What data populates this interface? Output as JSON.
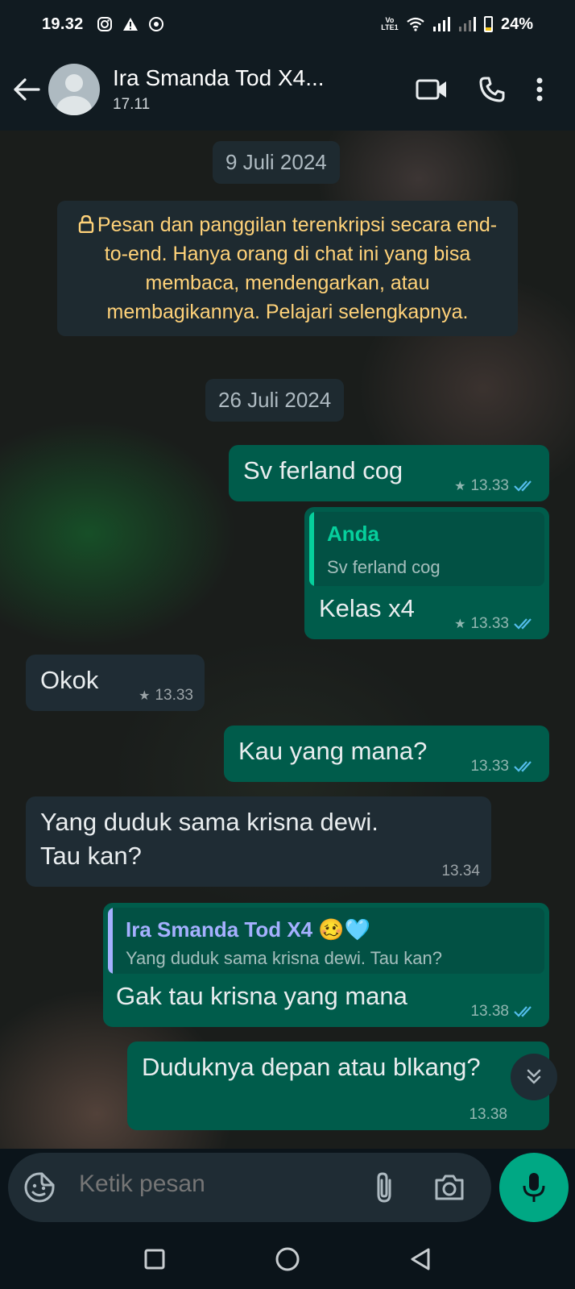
{
  "status_bar": {
    "time": "19.32",
    "left_icons": [
      "instagram-icon",
      "warning-icon",
      "app-notification-icon"
    ],
    "network_label": "Vo LTE1",
    "battery": "24%"
  },
  "header": {
    "contact_name": "Ira Smanda Tod X4...",
    "contact_status": "17.11"
  },
  "chat": {
    "date_1": "9 Juli 2024",
    "encryption_notice": "Pesan dan panggilan terenkripsi secara end-to-end. Hanya orang di chat ini yang bisa membaca, mendengarkan, atau membagikannya. Pelajari selengkapnya.",
    "date_2": "26 Juli 2024",
    "messages": [
      {
        "direction": "out",
        "text": "Sv ferland cog",
        "time": "13.33",
        "starred": true,
        "status": "read"
      },
      {
        "direction": "out",
        "quote_name": "Anda",
        "quote_text": "Sv ferland cog",
        "text": "Kelas x4",
        "time": "13.33",
        "starred": true,
        "status": "read"
      },
      {
        "direction": "in",
        "text": "Okok",
        "time": "13.33",
        "starred": true
      },
      {
        "direction": "out",
        "text": "Kau yang mana?",
        "time": "13.33",
        "status": "read"
      },
      {
        "direction": "in",
        "text_line_1": "Yang duduk sama krisna dewi.",
        "text_line_2": "Tau kan?",
        "time": "13.34"
      },
      {
        "direction": "out",
        "quote_name": "Ira Smanda Tod X4 🥴🩵",
        "quote_text": "Yang duduk sama krisna dewi. Tau kan?",
        "text": "Gak tau krisna yang mana",
        "time": "13.38",
        "status": "read"
      },
      {
        "direction": "out",
        "text": "Duduknya depan atau blkang?",
        "time": "13.38"
      }
    ]
  },
  "input": {
    "placeholder": "Ketik pesan"
  },
  "colors": {
    "outgoing_bubble": "#005c4b",
    "incoming_bubble": "#1f2c34",
    "accent_green": "#00a884",
    "read_tick": "#53bdeb",
    "quote_self_bar": "#06cf9c",
    "quote_contact_bar": "#a5b0ff",
    "system_text": "#ffd279"
  }
}
